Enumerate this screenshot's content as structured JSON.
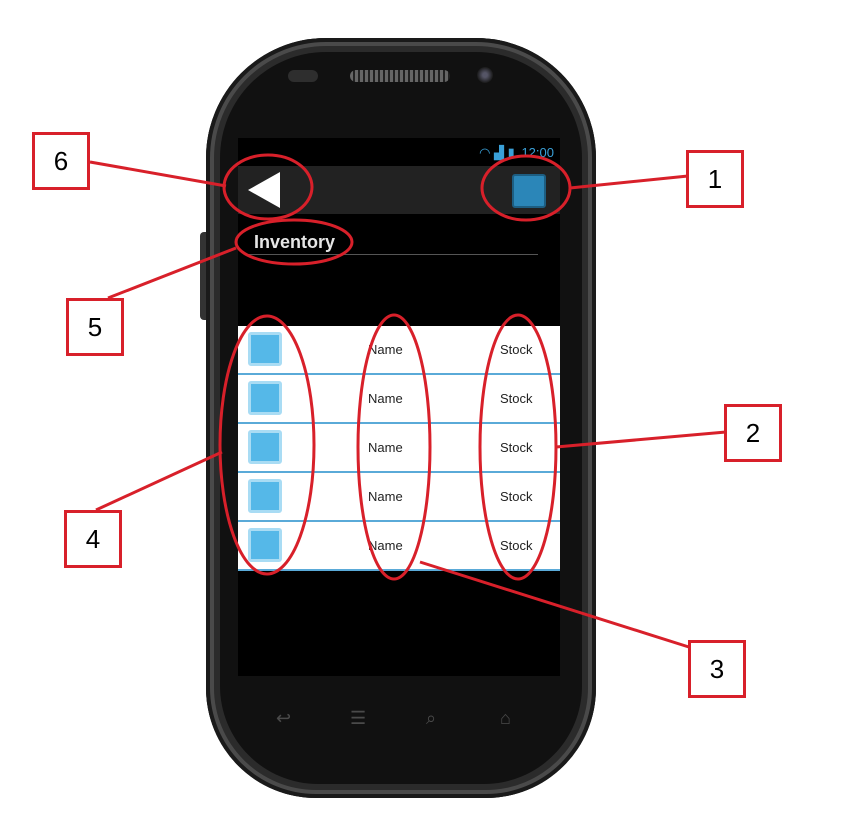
{
  "app": {
    "title": "Inventory"
  },
  "statusbar": {
    "time": "12:00"
  },
  "list": {
    "rows": [
      {
        "name": "Name",
        "stock": "Stock"
      },
      {
        "name": "Name",
        "stock": "Stock"
      },
      {
        "name": "Name",
        "stock": "Stock"
      },
      {
        "name": "Name",
        "stock": "Stock"
      },
      {
        "name": "Name",
        "stock": "Stock"
      }
    ]
  },
  "callouts": [
    "1",
    "2",
    "3",
    "4",
    "5",
    "6"
  ],
  "colors": {
    "accent": "#3aa0d8",
    "callout": "#d8202a",
    "actionbar": "#222222"
  },
  "icons": [
    "back-arrow-icon",
    "action-square-icon",
    "wifi-icon",
    "signal-icon",
    "battery-icon",
    "back-nav-icon",
    "menu-nav-icon",
    "search-nav-icon",
    "home-nav-icon"
  ]
}
